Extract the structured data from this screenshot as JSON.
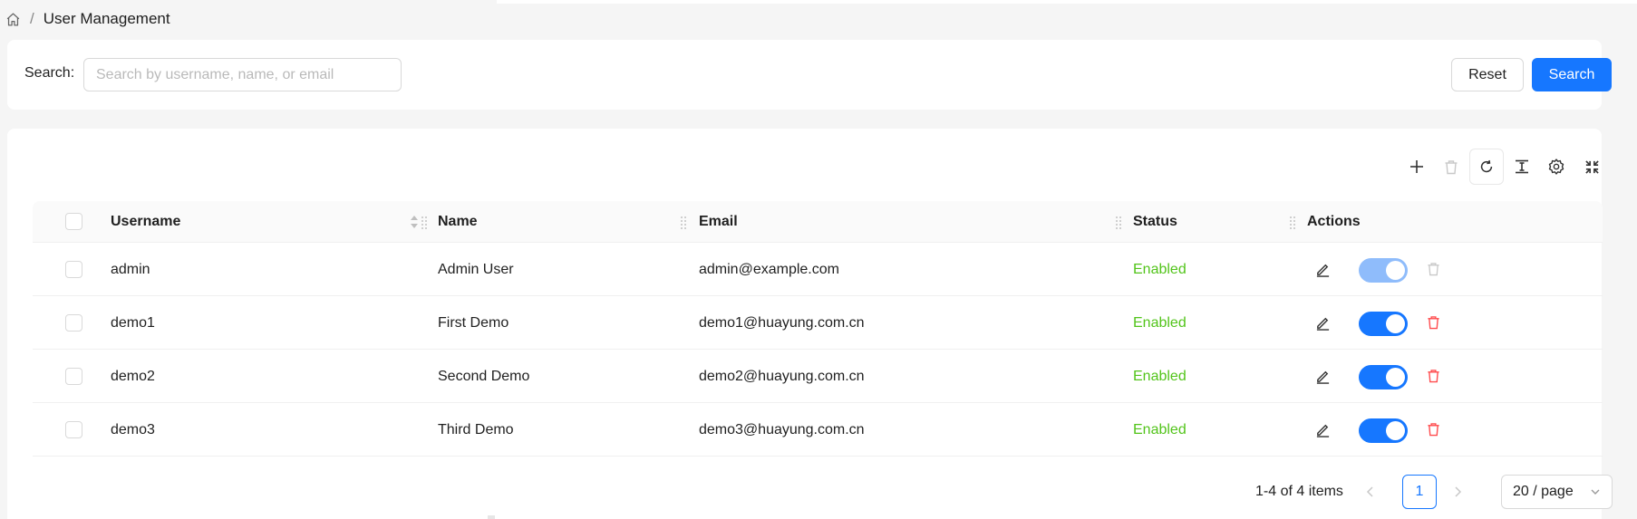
{
  "breadcrumb": {
    "separator": "/",
    "current": "User Management"
  },
  "search": {
    "label": "Search:",
    "placeholder": "Search by username, name, or email",
    "value": "",
    "reset_label": "Reset",
    "search_label": "Search"
  },
  "toolbar": {
    "icons": [
      "plus-icon",
      "delete-icon",
      "reload-icon",
      "column-height-icon",
      "setting-icon",
      "fullscreen-icon"
    ]
  },
  "table": {
    "columns": [
      "Username",
      "Name",
      "Email",
      "Status",
      "Actions"
    ],
    "rows": [
      {
        "username": "admin",
        "name": "Admin User",
        "email": "admin@example.com",
        "status": "Enabled",
        "enabled": true,
        "toggle_disabled": true,
        "delete_disabled": true
      },
      {
        "username": "demo1",
        "name": "First Demo",
        "email": "demo1@huayung.com.cn",
        "status": "Enabled",
        "enabled": true,
        "toggle_disabled": false,
        "delete_disabled": false
      },
      {
        "username": "demo2",
        "name": "Second Demo",
        "email": "demo2@huayung.com.cn",
        "status": "Enabled",
        "enabled": true,
        "toggle_disabled": false,
        "delete_disabled": false
      },
      {
        "username": "demo3",
        "name": "Third Demo",
        "email": "demo3@huayung.com.cn",
        "status": "Enabled",
        "enabled": true,
        "toggle_disabled": false,
        "delete_disabled": false
      }
    ]
  },
  "pagination": {
    "total_text": "1-4 of 4 items",
    "current_page": "1",
    "page_size": "20 / page"
  },
  "colors": {
    "primary": "#1677ff",
    "success": "#52c41a",
    "danger": "#ff4d4f"
  }
}
